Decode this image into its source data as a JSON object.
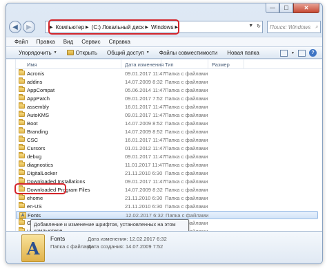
{
  "address": {
    "crumbs": [
      "Компьютер",
      "(C:) Локальный диск",
      "Windows"
    ],
    "search_placeholder": "Поиск: Windows"
  },
  "menu": [
    "Файл",
    "Правка",
    "Вид",
    "Сервис",
    "Справка"
  ],
  "toolbar": {
    "organize": "Упорядочить",
    "open": "Открыть",
    "share": "Общий доступ",
    "compat": "Файлы совместимости",
    "new_folder": "Новая папка"
  },
  "columns": {
    "name": "Имя",
    "date": "Дата изменения",
    "type": "Тип",
    "size": "Размер"
  },
  "rows": [
    {
      "name": "Acronis",
      "date": "09.01.2017 11:47",
      "type": "Папка с файлами"
    },
    {
      "name": "addins",
      "date": "14.07.2009 8:32",
      "type": "Папка с файлами"
    },
    {
      "name": "AppCompat",
      "date": "05.06.2014 11:47",
      "type": "Папка с файлами"
    },
    {
      "name": "AppPatch",
      "date": "09.01.2017 7:52",
      "type": "Папка с файлами"
    },
    {
      "name": "assembly",
      "date": "16.01.2017 11:47",
      "type": "Папка с файлами"
    },
    {
      "name": "AutoKMS",
      "date": "09.01.2017 11:47",
      "type": "Папка с файлами"
    },
    {
      "name": "Boot",
      "date": "14.07.2009 8:52",
      "type": "Папка с файлами"
    },
    {
      "name": "Branding",
      "date": "14.07.2009 8:52",
      "type": "Папка с файлами"
    },
    {
      "name": "CSC",
      "date": "16.01.2017 11:47",
      "type": "Папка с файлами"
    },
    {
      "name": "Cursors",
      "date": "01.01.2012 11:47",
      "type": "Папка с файлами"
    },
    {
      "name": "debug",
      "date": "09.01.2017 11:47",
      "type": "Папка с файлами"
    },
    {
      "name": "diagnostics",
      "date": "11.01.2017 11:47",
      "type": "Папка с файлами"
    },
    {
      "name": "DigitalLocker",
      "date": "21.11.2010 6:30",
      "type": "Папка с файлами"
    },
    {
      "name": "Downloaded Installations",
      "date": "09.01.2017 11:47",
      "type": "Папка с файлами"
    },
    {
      "name": "Downloaded Program Files",
      "date": "14.07.2009 8:32",
      "type": "Папка с файлами"
    },
    {
      "name": "ehome",
      "date": "21.11.2010 6:30",
      "type": "Папка с файлами"
    },
    {
      "name": "en-US",
      "date": "21.11.2010 6:30",
      "type": "Папка с файлами"
    },
    {
      "name": "Fonts",
      "date": "12.02.2017 6:32",
      "type": "Папка с файлами"
    },
    {
      "name": "Globalization",
      "date": "",
      "type": "Папка с файлами"
    },
    {
      "name": "Help",
      "date": "",
      "type": "Папка с файлами"
    }
  ],
  "tooltip": "Добавление и изменение шрифтов, установленных на этом компьютере.",
  "details": {
    "name": "Fonts",
    "kind": "Папка с файлами",
    "modified": "Дата изменения: 12.02.2017 6:32",
    "created": "Дата создания: 14.07.2009 7:52"
  }
}
